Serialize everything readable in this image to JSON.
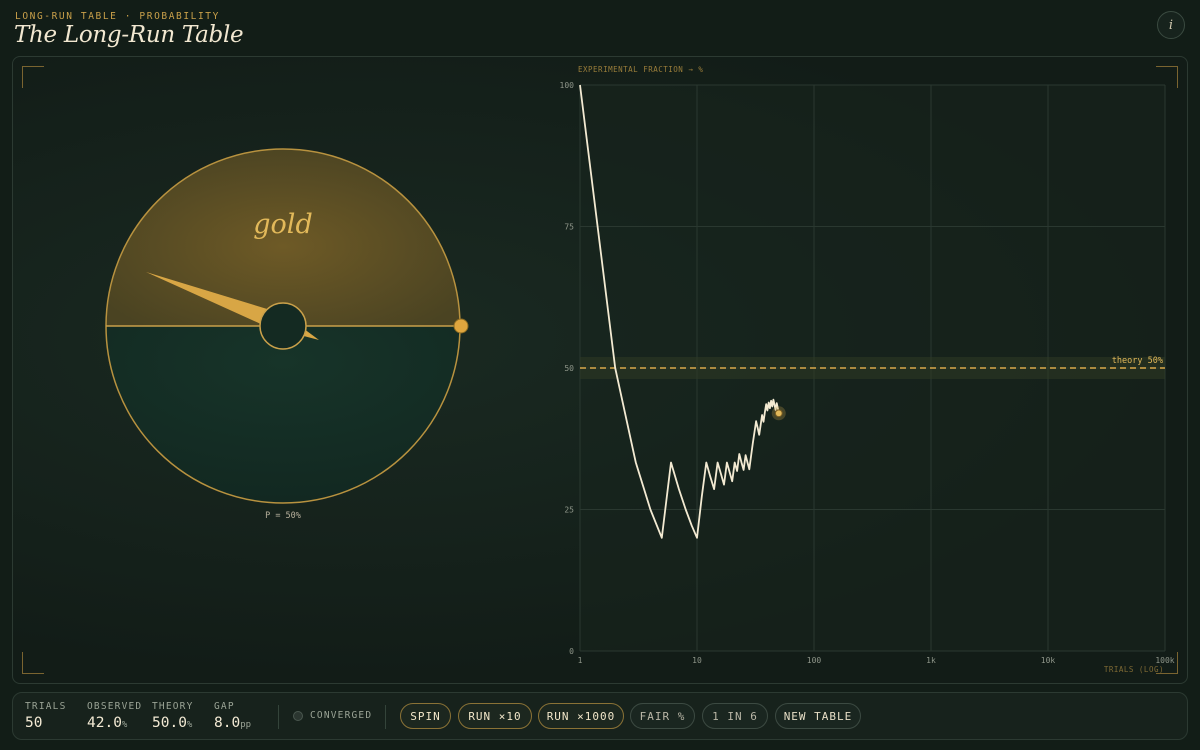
{
  "header": {
    "eyebrow": "LONG-RUN TABLE · PROBABILITY",
    "title": "The Long-Run Table",
    "info_label": "i"
  },
  "wheel": {
    "winning_label": "gold",
    "probability_label": "P = 50%",
    "colors": {
      "gold": "#c9a04a",
      "green": "#163026",
      "rim": "#c9a04a"
    }
  },
  "chart_data": {
    "type": "line",
    "title": "EXPERIMENTAL FRACTION → %",
    "xlabel": "TRIALS (LOG)",
    "ylabel": "",
    "x_scale": "log",
    "xlim": [
      1,
      100000
    ],
    "ylim": [
      0,
      100
    ],
    "x_ticks": [
      1,
      10,
      100,
      1000,
      10000,
      100000
    ],
    "x_tick_labels": [
      "1",
      "10",
      "100",
      "1k",
      "10k",
      "100k"
    ],
    "y_ticks": [
      0,
      25,
      50,
      75,
      100
    ],
    "y_tick_labels": [
      "0",
      "25",
      "50",
      "75",
      "100"
    ],
    "theory_value": 50,
    "theory_label": "theory 50%",
    "grid": true,
    "series": [
      {
        "values_x": [
          1,
          2,
          3,
          4,
          5,
          6,
          7,
          8,
          9,
          10,
          11,
          12,
          13,
          14,
          15,
          16,
          17,
          18,
          19,
          20,
          21,
          22,
          23,
          24,
          25,
          26,
          27,
          28,
          29,
          30,
          31,
          32,
          33,
          34,
          35,
          36,
          37,
          38,
          39,
          40,
          41,
          42,
          43,
          44,
          45,
          46,
          47,
          48,
          49,
          50
        ],
        "values_y": [
          100,
          50,
          33.3,
          25,
          20,
          33.3,
          28.6,
          25,
          22.2,
          20,
          27.3,
          33.3,
          30.8,
          28.6,
          33.3,
          31.3,
          29.4,
          33.3,
          31.6,
          30,
          33.3,
          31.8,
          34.8,
          33.3,
          32,
          34.6,
          33.3,
          32.1,
          34.5,
          36.7,
          38.7,
          40.6,
          39.4,
          38.2,
          40,
          41.7,
          40.5,
          42.1,
          43.6,
          42.5,
          43.9,
          42.9,
          44.2,
          43.2,
          44.4,
          43.5,
          42.6,
          43.8,
          42.9,
          42
        ]
      }
    ]
  },
  "stats": {
    "trials": {
      "label": "TRIALS",
      "value": "50",
      "unit": ""
    },
    "observed": {
      "label": "OBSERVED",
      "value": "42.0",
      "unit": "%"
    },
    "theory": {
      "label": "THEORY",
      "value": "50.0",
      "unit": "%"
    },
    "gap": {
      "label": "GAP",
      "value": "8.0",
      "unit": "pp"
    }
  },
  "converged_label": "CONVERGED",
  "controls": {
    "spin": "SPIN",
    "run10": "RUN ×10",
    "run1000": "RUN ×1000",
    "fair": "FAIR %",
    "one_in_six": "1 IN 6",
    "new_table": "NEW TABLE"
  }
}
